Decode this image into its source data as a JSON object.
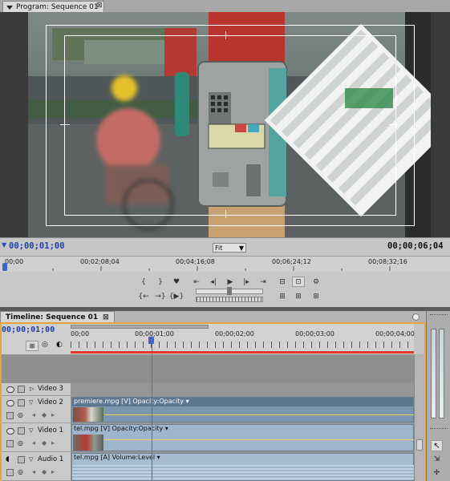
{
  "program_monitor": {
    "tab_label": "Program: Sequence 01",
    "close_glyph": "⊠",
    "current_timecode": "00;00;01;00",
    "duration_timecode": "00;00;06;04",
    "zoom": "Fit",
    "ruler_labels": [
      "00;00",
      "00;02;08;04",
      "00;04;16;08",
      "00;06;24;12",
      "00;08;32;16"
    ]
  },
  "transport": {
    "row1": [
      "{",
      "}",
      "♥",
      "⇤",
      "◂|",
      "▶",
      "|▸",
      "⇥"
    ],
    "row2": [
      "{←",
      "→}",
      "{▶}"
    ],
    "right_row1": [
      "⊟",
      "⊡",
      "⚙"
    ],
    "right_row2": [
      "⊞",
      "⊞",
      "⊞"
    ]
  },
  "timeline": {
    "tab_label": "Timeline: Sequence 01",
    "close_glyph": "⊠",
    "current_timecode": "00;00;01;00",
    "ruler_labels": [
      "00;00",
      "00;00;01;00",
      "00;00;02;00",
      "00;00;03;00",
      "00;00;04;00"
    ],
    "tracks": [
      {
        "name": "Video 3"
      },
      {
        "name": "Video 2",
        "clip": "premiere.mpg [V]  Opacity:Opacity ▾"
      },
      {
        "name": "Video 1",
        "clip": "tel.mpg [V]  Opacity:Opacity ▾"
      },
      {
        "name": "Audio 1",
        "clip": "tel.mpg [A]  Volume:Level ▾"
      }
    ]
  },
  "colors": {
    "accent_orange": "#e7a43a",
    "playhead": "#e23b2b",
    "timecode_blue": "#1f3fa8",
    "clip_blue": "#9fb5cc"
  }
}
